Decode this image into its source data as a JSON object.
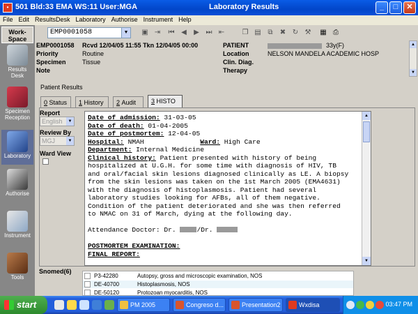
{
  "window": {
    "left_title": "501 Bld:33 EMA WS:11 User:MGA",
    "center_title": "Laboratory Results",
    "minimize": "_",
    "maximize": "□",
    "close": "✕"
  },
  "menu": [
    "File",
    "Edit",
    "ResultsDesk",
    "Laboratory",
    "Authorise",
    "Instrument",
    "Help"
  ],
  "toolbar": {
    "specimen_combo": "EMP0001058"
  },
  "workspace": {
    "title_line1": "Work-",
    "title_line2": "Space",
    "items": [
      {
        "label": "Results Desk",
        "icon": "results-desk-icon"
      },
      {
        "label": "Specimen Reception",
        "icon": "specimen-reception-icon"
      },
      {
        "label": "Laboratory",
        "icon": "laboratory-icon"
      },
      {
        "label": "Authorise",
        "icon": "authorise-icon"
      },
      {
        "label": "Instrument",
        "icon": "instrument-icon"
      },
      {
        "label": "Tools",
        "icon": "tools-icon"
      }
    ]
  },
  "header": {
    "specimen_no": "EMP0001058",
    "received": "Rcvd 12/04/05 11:55 Tkn 12/04/05 00:00",
    "priority_label": "Priority",
    "priority_value": "Routine",
    "specimen_label": "Specimen",
    "specimen_value": "Tissue",
    "note_label": "Note",
    "patient_label": "PATIENT",
    "patient_value": "33y(F)",
    "location_label": "Location",
    "location_value": "NELSON MANDELA ACADEMIC HOSP",
    "clin_label": "Clin. Diag.",
    "therapy_label": "Therapy"
  },
  "results": {
    "title": "Patient Results",
    "tabs": [
      {
        "key": "0",
        "label": "Status"
      },
      {
        "key": "1",
        "label": "History"
      },
      {
        "key": "2",
        "label": "Audit"
      },
      {
        "key": "3",
        "label": "HISTO"
      }
    ],
    "report_label": "Report",
    "report_value": "English",
    "review_label": "Review By",
    "review_value": "MGJ",
    "ward_view_label": "Ward View",
    "report_lines": {
      "l1_label": "Date of admission:",
      "l1_value": " 31-03-05",
      "l2_label": "Date of death:",
      "l2_value": " 01-04-2005",
      "l3_label": "Date of postmortem:",
      "l3_value": " 12-04-05",
      "l4_label": "Hospital:",
      "l4_value": " NMAH",
      "l4_ward_label": "Ward:",
      "l4_ward_value": " High Care",
      "l5_label": "Department:",
      "l5_value": " Internal Medicine",
      "l6_label": "Clinical history:",
      "l6_value": " Patient presented with history of being",
      "l7": "hospitalized at U.G.H. for some time with diagnosis of HIV, TB",
      "l8": "and oral/facial skin lesions diagnosed clinically as LE. A biopsy",
      "l9": "from the skin lesions was taken on the 1st March 2005 (EMA4631)",
      "l10": "with the diagnosis of histoplasmosis. Patient had several",
      "l11": "laboratory studies looking for AFBs, all of them negative.",
      "l12": "Condition of the patient deteriorated and she was then referred",
      "l13": "to NMAC on 31 of March, dying at the following day.",
      "l14_a": "Attendance Doctor: Dr.",
      "l14_b": "/Dr.",
      "l15": "POSTMORTEM EXAMINATION:",
      "l16": "FINAL REPORT:"
    }
  },
  "snomed": {
    "label": "Snomed(6)",
    "rows": [
      {
        "code": "P3-42280",
        "desc": "Autopsy, gross and microscopic examination, NOS"
      },
      {
        "code": "DE-40700",
        "desc": "Histoplasmosis, NOS"
      },
      {
        "code": "DE-50120",
        "desc": "Protozoan myocarditis, NOS"
      }
    ]
  },
  "taskbar": {
    "start": "start",
    "tasks": [
      "PM 2005",
      "Congreso d...",
      "Presentation2",
      "Wxdisa"
    ],
    "clock": "03:47 PM"
  }
}
